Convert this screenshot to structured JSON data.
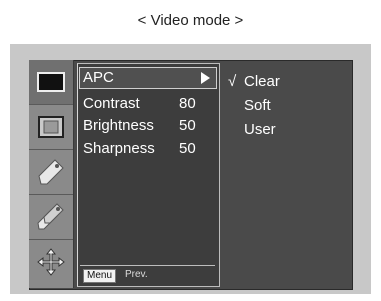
{
  "heading": "< Video mode >",
  "menu": {
    "items": [
      {
        "label": "APC",
        "value": ""
      },
      {
        "label": "Contrast",
        "value": "80"
      },
      {
        "label": "Brightness",
        "value": "50"
      },
      {
        "label": "Sharpness",
        "value": "50"
      }
    ],
    "footer": {
      "menu_label": "Menu",
      "prev_label": "Prev."
    }
  },
  "submenu": {
    "options": [
      {
        "label": "Clear",
        "selected": true
      },
      {
        "label": "Soft",
        "selected": false
      },
      {
        "label": "User",
        "selected": false
      }
    ],
    "check_glyph": "√"
  },
  "icons": [
    "picture-icon",
    "screen-icon",
    "tag-icon",
    "dual-tag-icon",
    "move-arrows-icon"
  ],
  "colors": {
    "panel_bg": "#4a4a4a",
    "frame_bg": "#c8c8c8",
    "text": "#ffffff"
  }
}
